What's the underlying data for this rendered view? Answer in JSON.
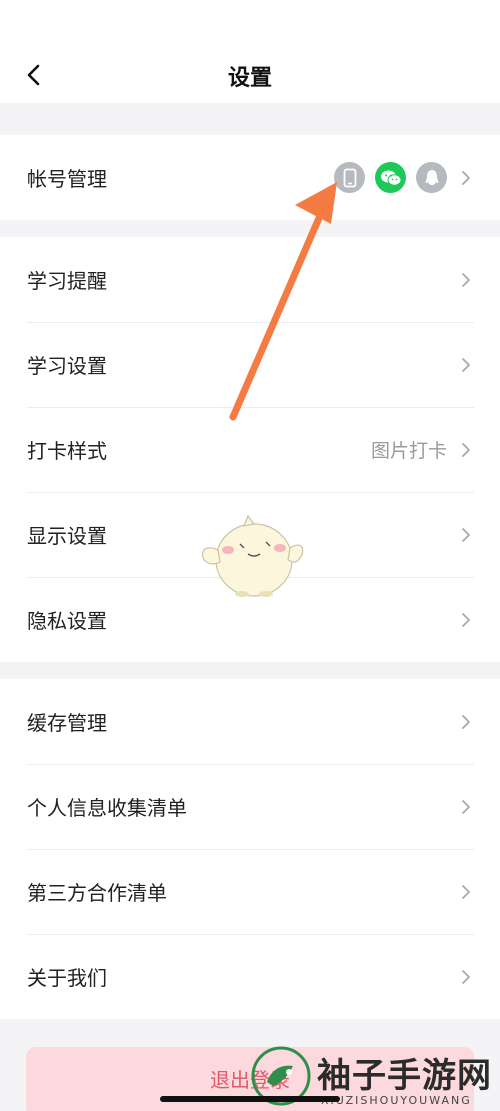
{
  "header": {
    "title": "设置"
  },
  "account": {
    "label": "帐号管理",
    "bound_icons": [
      "phone-icon",
      "wechat-icon",
      "qq-icon"
    ]
  },
  "sections": {
    "study": [
      {
        "label": "学习提醒",
        "value": ""
      },
      {
        "label": "学习设置",
        "value": ""
      },
      {
        "label": "打卡样式",
        "value": "图片打卡"
      },
      {
        "label": "显示设置",
        "value": ""
      },
      {
        "label": "隐私设置",
        "value": ""
      }
    ],
    "other": [
      {
        "label": "缓存管理"
      },
      {
        "label": "个人信息收集清单"
      },
      {
        "label": "第三方合作清单"
      },
      {
        "label": "关于我们"
      }
    ]
  },
  "logout": {
    "label": "退出登录"
  },
  "watermark": {
    "text": "袖子手游网",
    "sub": "XIUZISHOUYOUWANG"
  },
  "colors": {
    "page_bg": "#f4f4f6",
    "phone_icon_bg": "#b6b9bf",
    "wechat_green": "#1ec85b",
    "qq_icon_bg": "#b6b9bf",
    "logout_bg": "#fbd9dc",
    "logout_text": "#e05a6a",
    "annotation_arrow": "#f47c42"
  }
}
